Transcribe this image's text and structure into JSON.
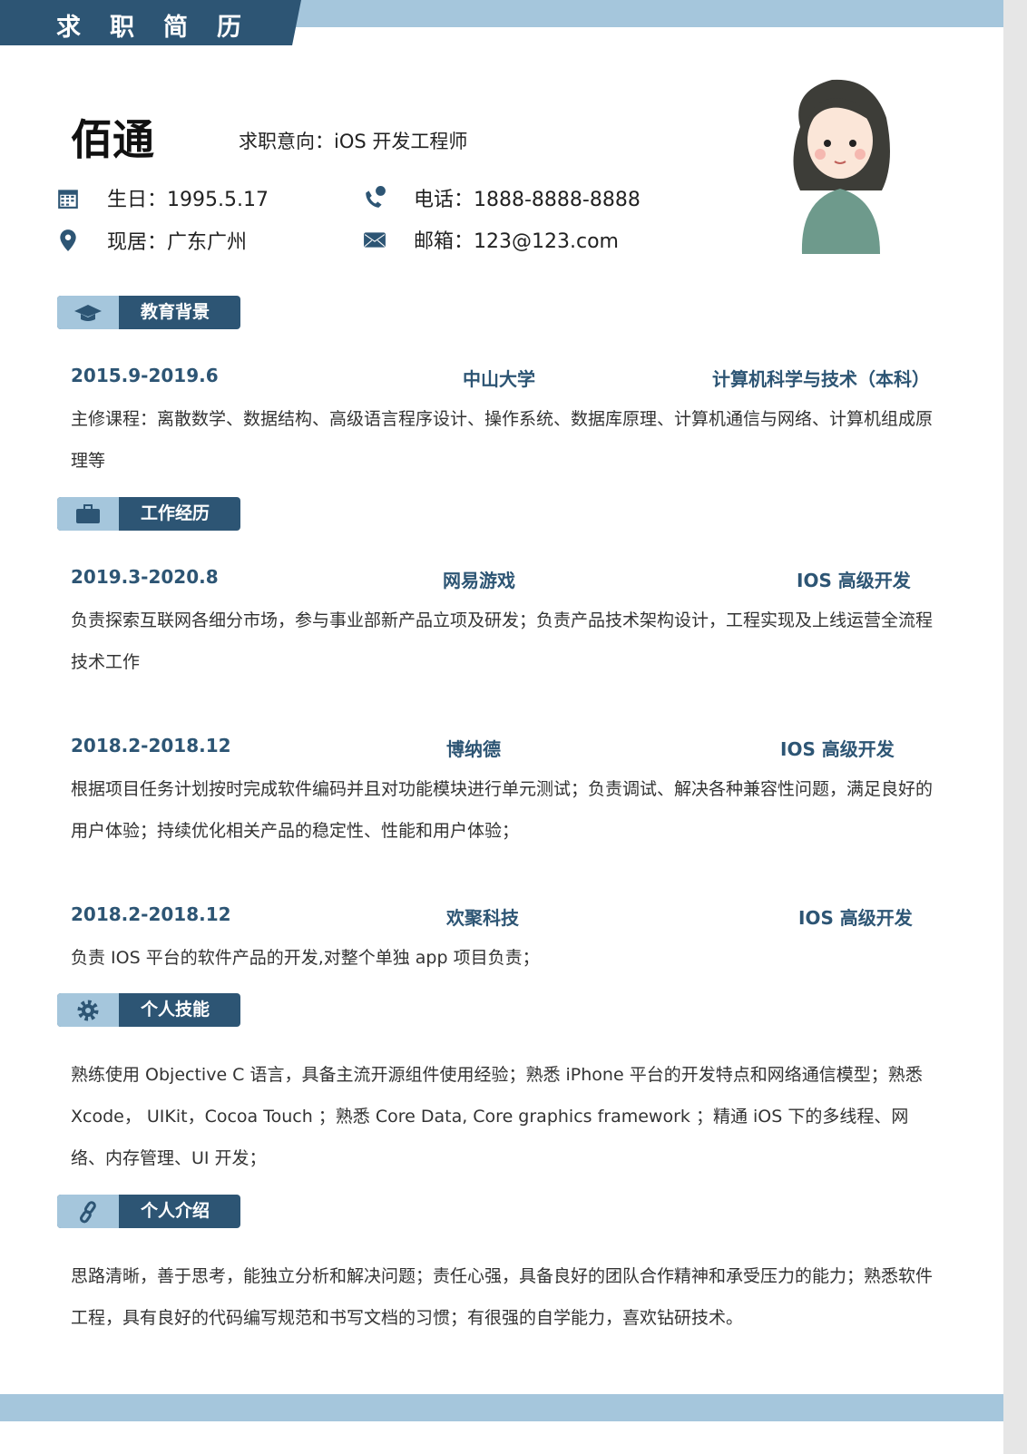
{
  "header": {
    "title": "求职简历",
    "name": "佰通",
    "intent": "求职意向：iOS 开发工程师"
  },
  "info": {
    "birthday": "生日：1995.5.17",
    "location": "现居：广东广州",
    "phone": "电话：1888-8888-8888",
    "email": "邮箱：123@123.com"
  },
  "colors": {
    "primary": "#2d5574",
    "accent": "#a5c6dc"
  },
  "sections": {
    "education": {
      "title": "教育背景",
      "icon": "graduation-cap-icon",
      "date": "2015.9-2019.6",
      "school": "中山大学",
      "major": "计算机科学与技术（本科）",
      "text": "主修课程：离散数学、数据结构、高级语言程序设计、操作系统、数据库原理、计算机通信与网络、计算机组成原理等"
    },
    "work": {
      "title": "工作经历",
      "icon": "briefcase-icon",
      "items": [
        {
          "date": "2019.3-2020.8",
          "company": "网易游戏",
          "role": "IOS 高级开发",
          "text": "负责探索互联网各细分市场，参与事业部新产品立项及研发；负责产品技术架构设计，工程实现及上线运营全流程技术工作"
        },
        {
          "date": "2018.2-2018.12",
          "company": "博纳德",
          "role": "IOS 高级开发",
          "text": "根据项目任务计划按时完成软件编码并且对功能模块进行单元测试；负责调试、解决各种兼容性问题，满足良好的用户体验；持续优化相关产品的稳定性、性能和用户体验；"
        },
        {
          "date": "2018.2-2018.12",
          "company": "欢聚科技",
          "role": "IOS 高级开发",
          "text": "负责 IOS 平台的软件产品的开发,对整个单独 app 项目负责；"
        }
      ]
    },
    "skills": {
      "title": "个人技能",
      "icon": "gear-icon",
      "text": "熟练使用 Objective C 语言，具备主流开源组件使用经验；熟悉 iPhone 平台的开发特点和网络通信模型；熟悉 Xcode， UIKit，Cocoa Touch ；熟悉 Core Data, Core graphics framework ；精通 iOS 下的多线程、网络、内存管理、UI 开发；"
    },
    "intro": {
      "title": "个人介绍",
      "icon": "link-icon",
      "text": "思路清晰，善于思考，能独立分析和解决问题；责任心强，具备良好的团队合作精神和承受压力的能力；熟悉软件工程，具有良好的代码编写规范和书写文档的习惯；有很强的自学能力，喜欢钻研技术。"
    }
  }
}
